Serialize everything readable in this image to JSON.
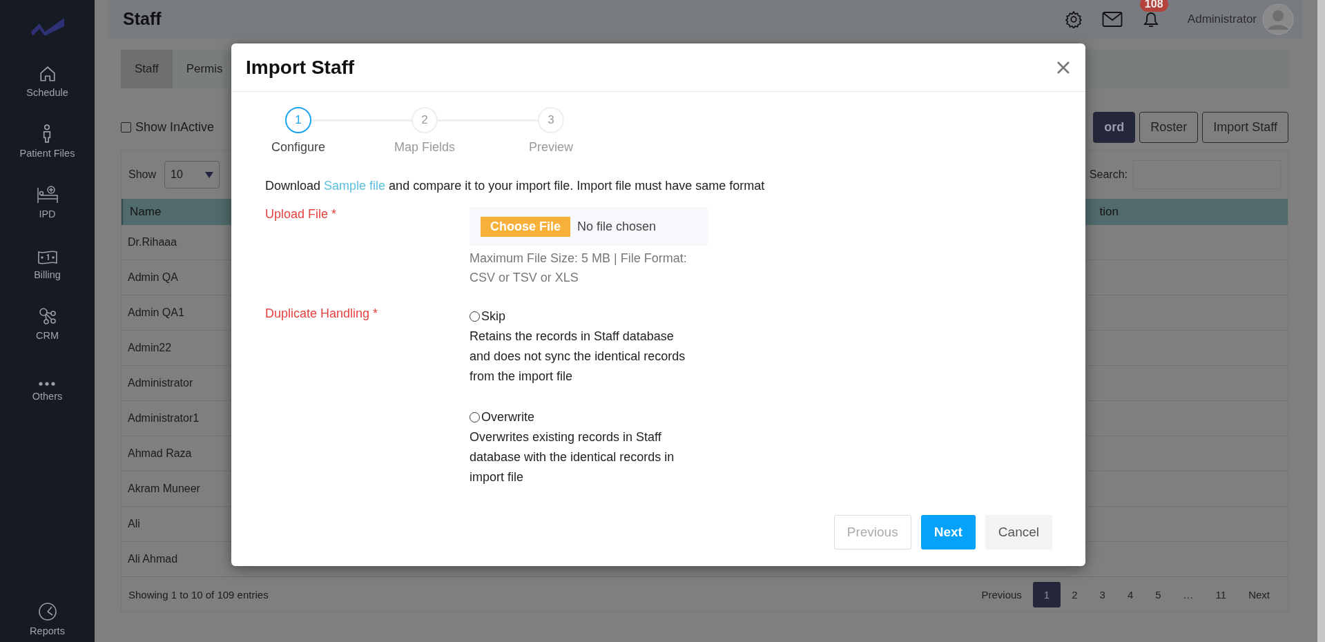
{
  "sidebar": {
    "items": [
      {
        "label": "Schedule"
      },
      {
        "label": "Patient Files"
      },
      {
        "label": "IPD"
      },
      {
        "label": "Billing"
      },
      {
        "label": "CRM"
      },
      {
        "label": "Others"
      },
      {
        "label": "Reports"
      }
    ]
  },
  "header": {
    "title": "Staff",
    "notification_count": "108",
    "user": "Administrator"
  },
  "tabs": [
    {
      "label": "Staff",
      "selected": true
    },
    {
      "label": "Permis",
      "selected": false
    }
  ],
  "show_inactive": {
    "label": "Show InActive",
    "checked": false
  },
  "toolbar_buttons": [
    {
      "label": "ord",
      "kind": "primary"
    },
    {
      "label": "Roster",
      "kind": "outline"
    },
    {
      "label": "Import Staff",
      "kind": "outline"
    }
  ],
  "table": {
    "length_label": "Show",
    "length_value": "10",
    "search_label": "Search:",
    "columns": [
      "Name",
      "tion"
    ],
    "rows": [
      "Dr.Rihaaa",
      "Admin QA",
      "Admin QA1",
      "Admin22",
      "Administrator",
      "Administrator1",
      "Ahmad Raza",
      "Akram Muneer",
      "Ali",
      "Ali Ahmad"
    ],
    "info": "Showing 1 to 10 of 109 entries",
    "pagination": [
      {
        "label": "Previous",
        "selected": false
      },
      {
        "label": "1",
        "selected": true
      },
      {
        "label": "2",
        "selected": false
      },
      {
        "label": "3",
        "selected": false
      },
      {
        "label": "4",
        "selected": false
      },
      {
        "label": "5",
        "selected": false
      },
      {
        "label": "…",
        "selected": false
      },
      {
        "label": "11",
        "selected": false
      },
      {
        "label": "Next",
        "selected": false
      }
    ]
  },
  "modal": {
    "title": "Import Staff",
    "steps": [
      {
        "number": "1",
        "label": "Configure",
        "active": true
      },
      {
        "number": "2",
        "label": "Map Fields",
        "active": false
      },
      {
        "number": "3",
        "label": "Preview",
        "active": false
      }
    ],
    "intro": {
      "before": "Download",
      "link": "Sample file",
      "after": "and compare it to your import file. Import file must have same format"
    },
    "upload": {
      "label": "Upload File *",
      "button": "Choose File",
      "status": "No file chosen",
      "hint": "Maximum File Size: 5 MB | File Format: CSV or TSV or XLS"
    },
    "duplicate": {
      "label": "Duplicate Handling *",
      "options": [
        {
          "label": "Skip",
          "checked": false,
          "description": "Retains the records in Staff database and does not sync the identical records from the import file"
        },
        {
          "label": "Overwrite",
          "checked": false,
          "description": "Overwrites existing records in Staff database with the identical records in import file"
        }
      ]
    },
    "buttons": [
      {
        "label": "Previous",
        "kind": "secondary",
        "disabled": true
      },
      {
        "label": "Next",
        "kind": "primary",
        "disabled": false
      },
      {
        "label": "Cancel",
        "kind": "light",
        "disabled": false
      }
    ]
  }
}
